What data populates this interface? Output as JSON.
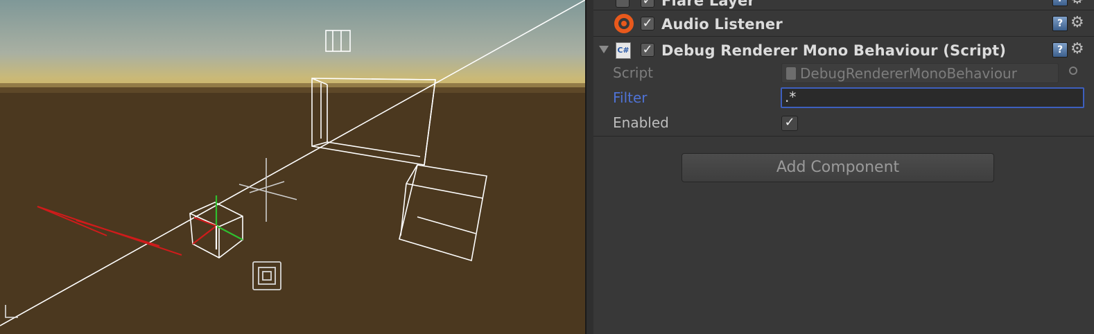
{
  "scene": {
    "colors": {
      "sky_top": "#8a9fa1",
      "sky_horizon": "#d8b661",
      "ground": "#4a3820",
      "wire": "#ffffff",
      "axis_red": "#d41b1b",
      "axis_green": "#2fbf2f"
    }
  },
  "inspector": {
    "components": [
      {
        "title": "Flare Layer",
        "enabled": true
      },
      {
        "title": "Audio Listener",
        "enabled": true,
        "icon": "audio-listener-icon"
      },
      {
        "title": "Debug Renderer Mono Behaviour (Script)",
        "enabled": true,
        "icon": "csharp-script-icon",
        "expanded": true
      }
    ],
    "properties": {
      "script_label": "Script",
      "script_value": "DebugRendererMonoBehaviour",
      "filter_label": "Filter",
      "filter_value": ".*",
      "enabled_label": "Enabled",
      "enabled_checked": true
    },
    "add_component_label": "Add Component",
    "help_icon_glyph": "?",
    "gear_glyph": "⚙",
    "check_glyph": "✓",
    "csharp_glyph": "C#"
  }
}
